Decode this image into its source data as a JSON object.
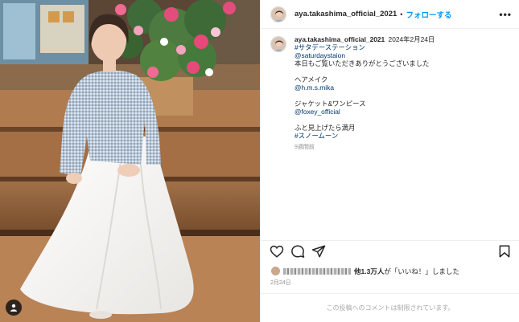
{
  "post": {
    "username": "aya.takashima_official_2021",
    "separator": "•",
    "follow_label": "フォローする",
    "more_icon": "•••",
    "caption": {
      "date": "2024年2月24日",
      "lines": [
        {
          "text": "#サタデーステーション",
          "type": "link"
        },
        {
          "text": "@saturdaystaion",
          "type": "link"
        },
        {
          "text": "本日もご覧いただきありがとうございました",
          "type": "text"
        },
        {
          "text": "",
          "type": "gap"
        },
        {
          "text": "ヘアメイク",
          "type": "text"
        },
        {
          "text": "@h.m.s.mika",
          "type": "link"
        },
        {
          "text": "",
          "type": "gap"
        },
        {
          "text": "ジャケット&ワンピース",
          "type": "text"
        },
        {
          "text": "@foxey_official",
          "type": "link"
        },
        {
          "text": "",
          "type": "gap"
        },
        {
          "text": "ふと見上げたら満月",
          "type": "text"
        },
        {
          "text": "#スノームーン",
          "type": "link"
        }
      ],
      "time_ago": "9週間前"
    },
    "likes": {
      "count_bold": "他1.3万人",
      "suffix": "が「いいね！」しました"
    },
    "post_date": "2月24日",
    "comments_limited": "この投稿へのコメントは制限されています。"
  },
  "icons": {
    "like": "heart-icon",
    "comment": "comment-icon",
    "share": "share-icon",
    "save": "bookmark-icon",
    "tag": "person-tag-icon",
    "more": "more-options-icon"
  },
  "colors": {
    "accent": "#0095f6",
    "link": "#00376b",
    "muted": "#8e8e8e"
  }
}
